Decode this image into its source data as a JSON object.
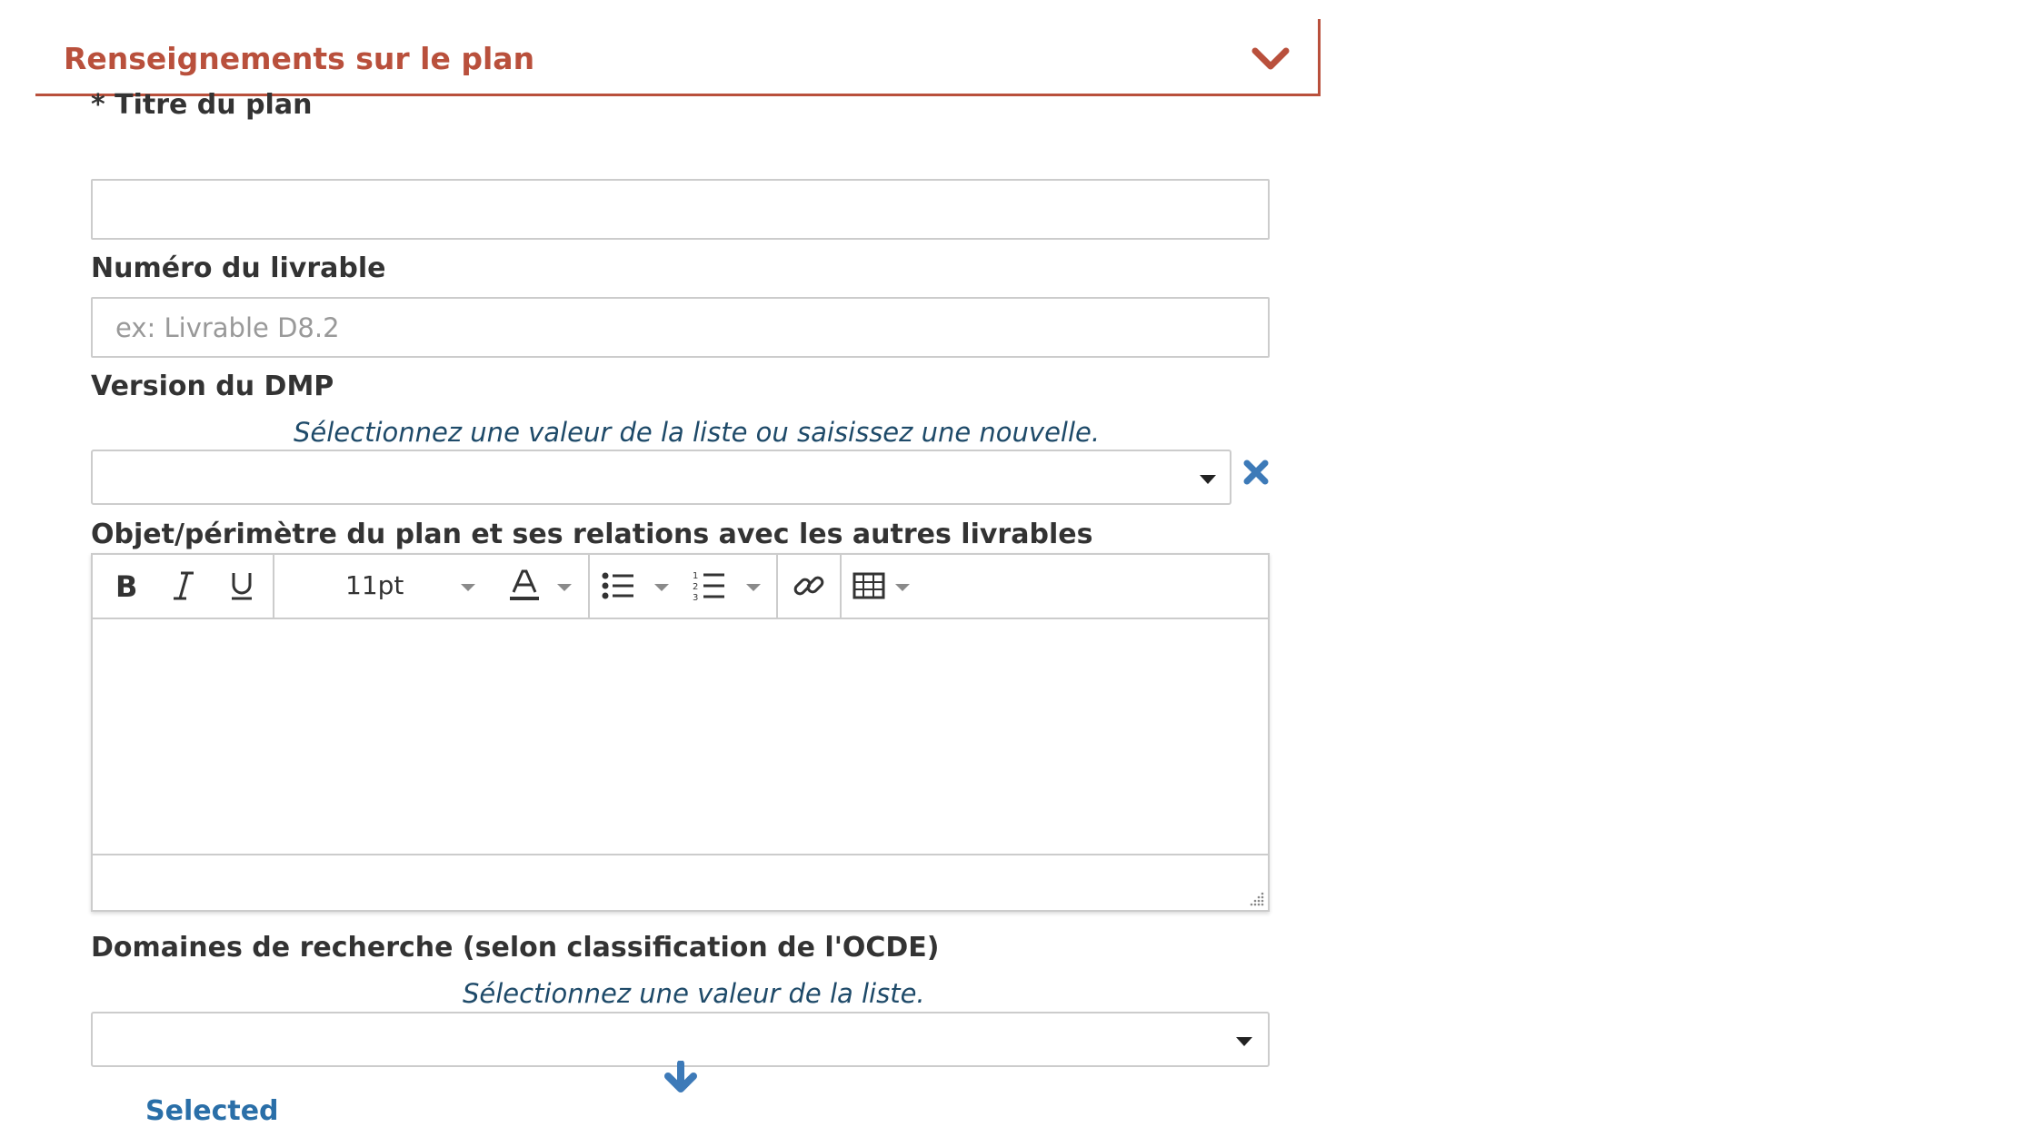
{
  "panel": {
    "title": "Renseignements sur le plan",
    "accent_color": "#b9503c",
    "toggle_icon": "chevron-down-icon"
  },
  "fields": {
    "title": {
      "label": "* Titre du plan",
      "value": ""
    },
    "deliverable_number": {
      "label": "Numéro du livrable",
      "value": "",
      "placeholder": "ex: Livrable D8.2"
    },
    "dmp_version": {
      "label": "Version du DMP",
      "help": "Sélectionnez une valeur de la liste ou saisissez une nouvelle.",
      "value": "",
      "clear_icon": "close-icon"
    },
    "scope": {
      "label": "Objet/périmètre du plan et ses relations avec les autres livrables",
      "toolbar": {
        "bold_icon": "bold-icon",
        "italic_icon": "italic-icon",
        "underline_icon": "underline-icon",
        "font_size": "11pt",
        "text_color_icon": "text-color-icon",
        "bullet_list_icon": "bullet-list-icon",
        "numbered_list_icon": "numbered-list-icon",
        "link_icon": "link-icon",
        "table_icon": "table-icon"
      },
      "value": ""
    },
    "research_domains": {
      "label": "Domaines de recherche (selon classification de l'OCDE)",
      "help": "Sélectionnez une valeur de la liste.",
      "value": "",
      "add_icon": "arrow-down-icon",
      "selected_label": "Selected"
    }
  },
  "colors": {
    "help_text": "#1e4a69",
    "icon_blue": "#3d7ab8",
    "border": "#cccccc"
  }
}
